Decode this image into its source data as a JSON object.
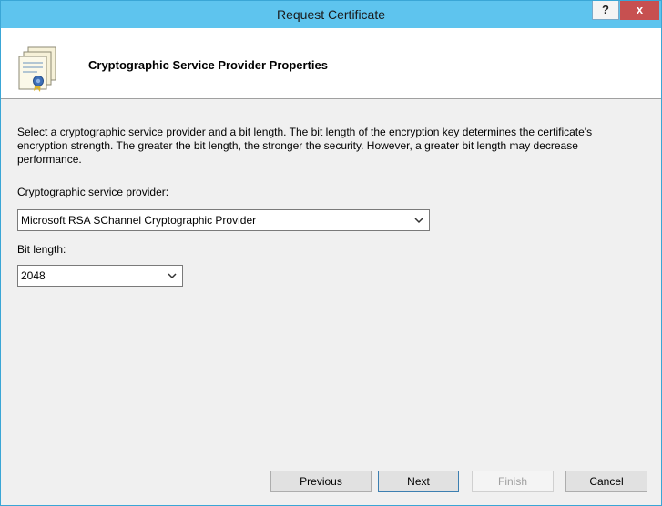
{
  "window": {
    "title": "Request Certificate",
    "help_label": "?",
    "close_label": "x"
  },
  "header": {
    "title": "Cryptographic Service Provider Properties",
    "icon": "certificate-icon"
  },
  "content": {
    "description": "Select a cryptographic service provider and a bit length. The bit length of the encryption key determines the certificate's encryption strength. The greater the bit length, the stronger the security. However, a greater bit length may decrease performance.",
    "provider_label": "Cryptographic service provider:",
    "provider_value": "Microsoft RSA SChannel Cryptographic Provider",
    "bits_label": "Bit length:",
    "bits_value": "2048"
  },
  "buttons": {
    "previous": "Previous",
    "next": "Next",
    "finish": "Finish",
    "cancel": "Cancel"
  },
  "colors": {
    "titlebar": "#5ec4ee",
    "close": "#c75050"
  }
}
